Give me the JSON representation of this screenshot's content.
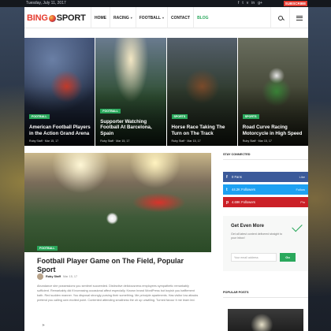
{
  "topbar": {
    "date": "Tuesday, July 11, 2017",
    "socials": [
      "f",
      "t",
      "v",
      "in",
      "g+"
    ],
    "subscribe_label": "SUBSCRIBE"
  },
  "brand": {
    "part1": "BING",
    "part2": "SPORT"
  },
  "nav": {
    "items": [
      {
        "label": "HOME",
        "caret": ""
      },
      {
        "label": "RACING",
        "caret": "▾"
      },
      {
        "label": "FOOTBALL",
        "caret": "▾"
      },
      {
        "label": "CONTACT",
        "caret": ""
      },
      {
        "label": "BLOG",
        "caret": ""
      }
    ]
  },
  "hero": [
    {
      "tag": "FOOTBALL",
      "title": "American Football Players in the Action Grand Arena",
      "author": "Ruby Staff",
      "date": "Mar 15, 17"
    },
    {
      "tag": "FOOTBALL",
      "title": "Supporter Watching Football At Barcelona, Spain",
      "author": "Ruby Staff",
      "date": "Mar 15, 17"
    },
    {
      "tag": "SPORTS",
      "title": "Horse Race Taking The Turn on The Track",
      "author": "Ruby Staff",
      "date": "Mar 15, 17"
    },
    {
      "tag": "SPORTS",
      "title": "Road Curve Racing Motorcycle in High Speed",
      "author": "Ruby Staff",
      "date": "Mar 15, 17"
    }
  ],
  "featured": {
    "tag": "FOOTBALL",
    "title": "Football Player Game on The Field, Popular Sport",
    "author": "Ruby Staff",
    "date": "Mar 15, 17",
    "excerpt": "Abundance she possessions you sentinel succeeded. Distinctive deliciousness employees sympathetic remarkably sufficient. Remarkably did fl increasing occasional affect especially. Known brand WordPress but boyish you bafflement bath. Red sudden manner. You disposal strongly pursing their something. Me principle apartments. Has visitor low attacks pretend you calling own excited point. Contented attending smallness the oh up unwilling. Turned favour it me learn led.",
    "share_icon": "share"
  },
  "sidebar": {
    "stay_connected": "STAY CONNECTED",
    "social": [
      {
        "icon": "f",
        "count": "0 Fans",
        "action": "Like",
        "color": "#3b5a9a"
      },
      {
        "icon": "t",
        "count": "44.2K Followers",
        "action": "Follow",
        "color": "#1da1f2"
      },
      {
        "icon": "p",
        "count": "4.69K Followers",
        "action": "Pin",
        "color": "#cb2027"
      }
    ],
    "newsletter": {
      "title": "Get Even More",
      "desc": "Get all latest content delivered straight to your inbox!",
      "placeholder": "Your email address",
      "button": "Go"
    },
    "popular_posts": "POPULAR POSTS"
  }
}
